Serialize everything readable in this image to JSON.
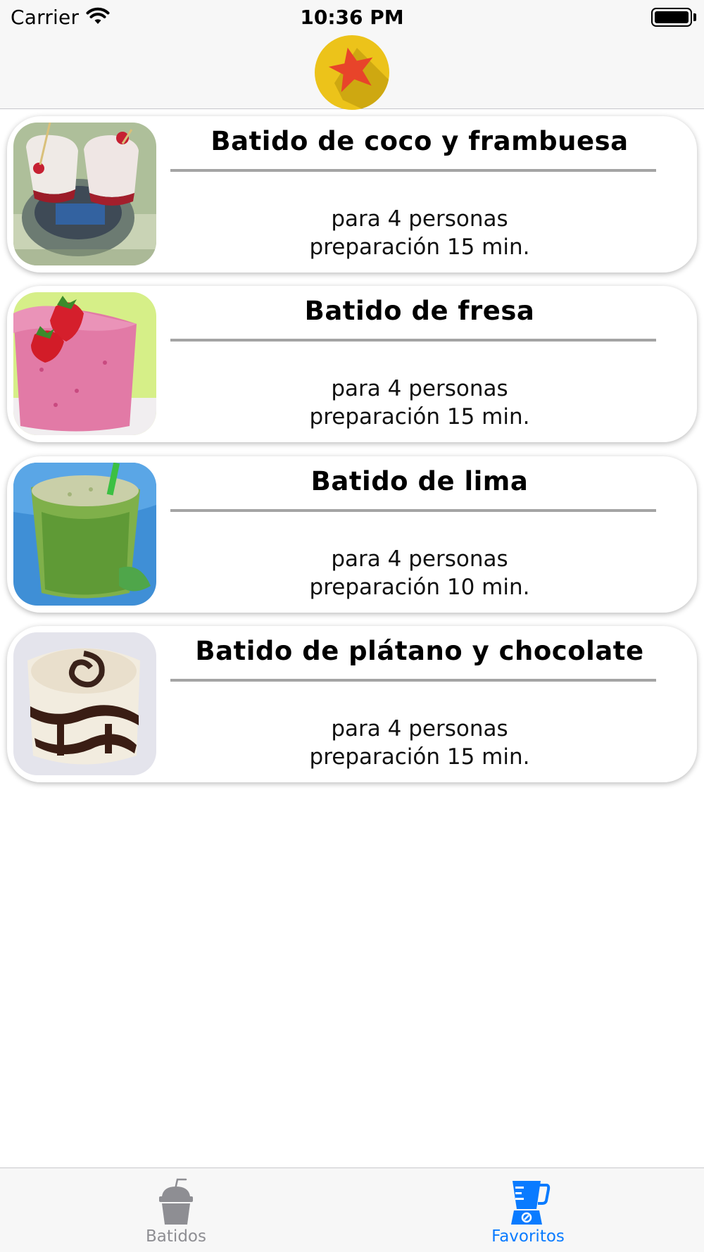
{
  "status_bar": {
    "carrier": "Carrier",
    "time": "10:36 PM"
  },
  "nav_bar": {
    "logo_icon": "star-badge-icon",
    "colors": {
      "badge": "#ecc31a",
      "star": "#e8442a"
    }
  },
  "recipes": [
    {
      "title": "Batido de coco y frambuesa",
      "servings": "para 4 personas",
      "prep_time": "preparación 15 min.",
      "image": "coconut-raspberry-shake-photo"
    },
    {
      "title": "Batido de fresa",
      "servings": "para 4 personas",
      "prep_time": "preparación 15 min.",
      "image": "strawberry-shake-photo"
    },
    {
      "title": "Batido de lima",
      "servings": "para 4 personas",
      "prep_time": "preparación 10 min.",
      "image": "lime-shake-photo"
    },
    {
      "title": "Batido de plátano y chocolate",
      "servings": "para 4 personas",
      "prep_time": "preparación 15 min.",
      "image": "banana-chocolate-shake-photo"
    }
  ],
  "tab_bar": {
    "tabs": [
      {
        "label": "Batidos",
        "icon": "cup-icon",
        "selected": false
      },
      {
        "label": "Favoritos",
        "icon": "blender-icon",
        "selected": true
      }
    ],
    "colors": {
      "active": "#0a7bff",
      "inactive": "#8e8e93"
    }
  }
}
